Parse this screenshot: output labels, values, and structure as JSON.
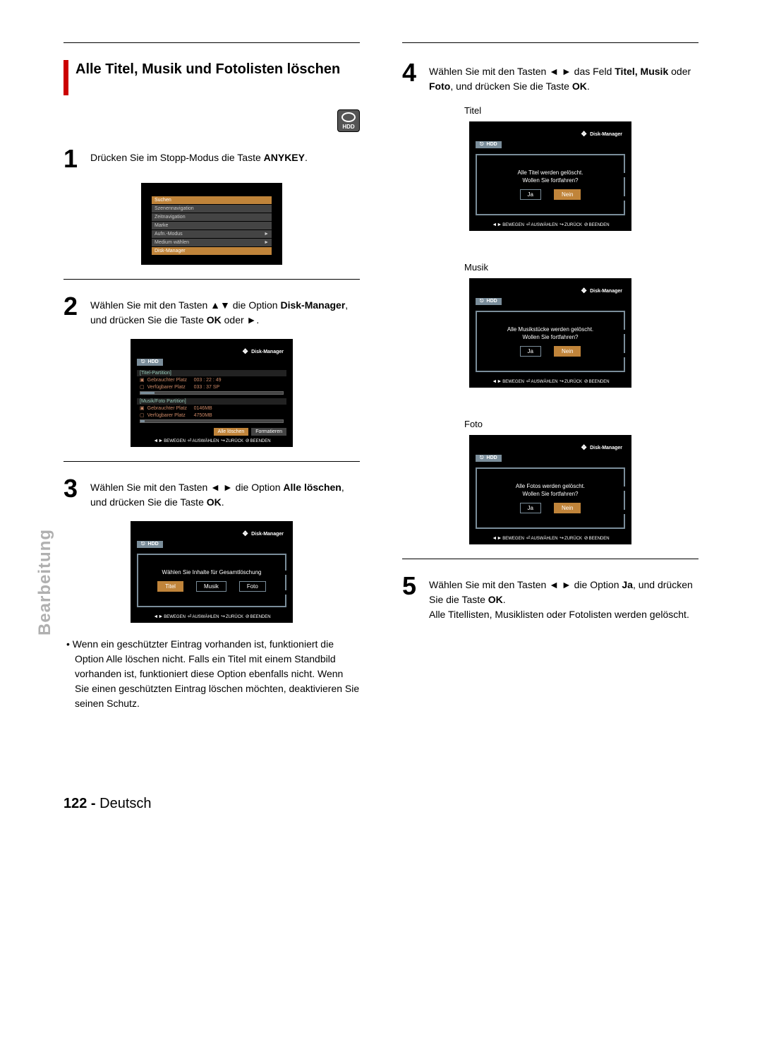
{
  "sidebar": {
    "label": "Bearbeitung"
  },
  "section": {
    "title": "Alle Titel, Musik und Fotolisten löschen"
  },
  "hdd_icon": {
    "label": "HDD"
  },
  "steps": {
    "s1": {
      "num": "1",
      "text_a": "Drücken Sie im Stopp-Modus die Taste ",
      "b1": "ANYKEY",
      "text_b": "."
    },
    "s2": {
      "num": "2",
      "text_a": "Wählen Sie mit den Tasten ▲▼ die Option ",
      "b1": "Disk-Manager",
      "text_b": ", und drücken Sie die Taste ",
      "b2": "OK",
      "text_c": " oder ►."
    },
    "s3": {
      "num": "3",
      "text_a": "Wählen Sie mit den Tasten ◄ ► die Option ",
      "b1": "Alle löschen",
      "text_b": ", und drücken Sie die Taste ",
      "b2": "OK",
      "text_c": "."
    },
    "s4": {
      "num": "4",
      "text_a": "Wählen Sie mit den Tasten ◄ ► das Feld ",
      "b1": "Titel, Musik",
      "text_b": " oder ",
      "b2": "Foto",
      "text_c": ", und drücken Sie die Taste ",
      "b3": "OK",
      "text_d": "."
    },
    "s5": {
      "num": "5",
      "text_a": "Wählen Sie mit den Tasten ◄ ► die Option ",
      "b1": "Ja",
      "text_b": ", und drücken Sie die Taste ",
      "b2": "OK",
      "text_c": ".",
      "extra": "Alle Titellisten, Musiklisten oder Fotolisten werden gelöscht."
    }
  },
  "note": "Wenn ein geschützter Eintrag vorhanden ist, funktioniert die Option Alle löschen nicht. Falls ein Titel mit einem Standbild vorhanden ist, funktioniert diese Option ebenfalls nicht. Wenn Sie einen geschützten Eintrag löschen möchten, deaktivieren Sie seinen Schutz.",
  "menu": {
    "items": [
      {
        "label": "Suchen"
      },
      {
        "label": "Szenennavigation"
      },
      {
        "label": "Zeitnavigation"
      },
      {
        "label": "Marke"
      },
      {
        "label": "Aufn.-Modus",
        "arrow": "►"
      },
      {
        "label": "Medium wählen",
        "arrow": "►"
      },
      {
        "label": "Disk-Manager",
        "hl": true
      }
    ]
  },
  "disk_manager": {
    "header": "Disk-Manager",
    "hdd": "HDD",
    "part1": {
      "title": "[Titel-Partition]",
      "used_label": "Gebrauchter Platz",
      "used_val": "003 : 22 : 49",
      "free_label": "Verfügbarer Platz",
      "free_val": "033 : 37 SP"
    },
    "part2": {
      "title": "[Musik/Foto Partition]",
      "used_label": "Gebrauchter Platz",
      "used_val": "0146MB",
      "free_label": "Verfügbarer Platz",
      "free_val": "4750MB"
    },
    "btn_delete": "Alle löschen",
    "btn_format": "Formatieren"
  },
  "select_content": {
    "prompt": "Wählen Sie Inhalte für Gesamtlöschung",
    "opt1": "Titel",
    "opt2": "Musik",
    "opt3": "Foto"
  },
  "confirm": {
    "titel": {
      "label": "Titel",
      "line1": "Alle Titel werden gelöscht.",
      "line2": "Wollen Sie fortfahren?"
    },
    "musik": {
      "label": "Musik",
      "line1": "Alle Musikstücke werden gelöscht.",
      "line2": "Wollen Sie fortfahren?"
    },
    "foto": {
      "label": "Foto",
      "line1": "Alle Fotos werden gelöscht.",
      "line2": "Wollen Sie fortfahren?"
    },
    "ja": "Ja",
    "nein": "Nein"
  },
  "footer_controls": {
    "move": "BEWEGEN",
    "select": "AUSWÄHLEN",
    "back": "ZURÜCK",
    "exit": "BEENDEN"
  },
  "page_footer": {
    "num": "122 -",
    "lang": "Deutsch"
  }
}
